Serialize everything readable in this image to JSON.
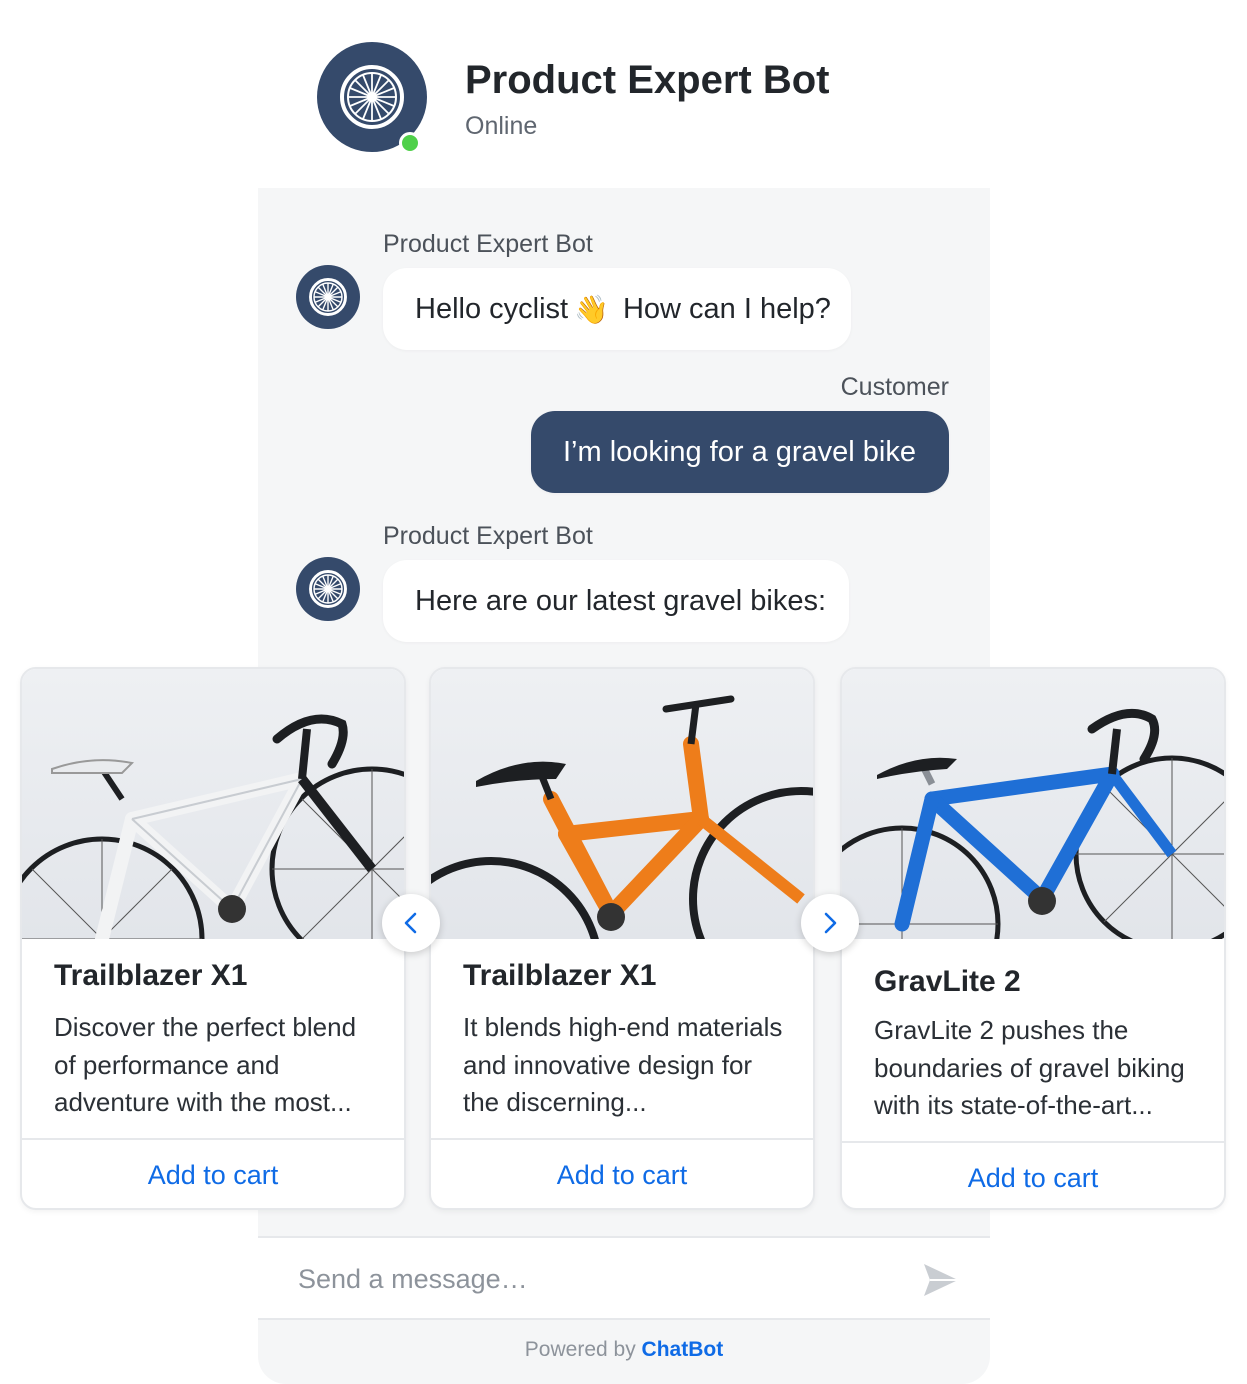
{
  "header": {
    "bot_name": "Product Expert Bot",
    "status": "Online",
    "status_color": "#4fd04a"
  },
  "messages": [
    {
      "sender": "Product Expert Bot",
      "text_before": "Hello cyclist",
      "emoji": "👋",
      "text_after": "How can I help?"
    },
    {
      "sender": "Customer",
      "text": "I’m looking for a gravel bike"
    },
    {
      "sender": "Product Expert Bot",
      "text": "Here are our latest gravel bikes:"
    }
  ],
  "cards": [
    {
      "title": "Trailblazer X1",
      "description": "Discover the perfect blend of performance and adventure with the most...",
      "button": "Add to cart",
      "frame_color": "#f2f3f4"
    },
    {
      "title": "Trailblazer X1",
      "description": "It blends high-end materials and innovative design for the discerning...",
      "button": "Add to cart",
      "frame_color": "#ee7d1a"
    },
    {
      "title": "GravLite 2",
      "description": "GravLite 2 pushes the boundaries of gravel biking with its state-of-the-art...",
      "button": "Add to cart",
      "frame_color": "#1f6fd6"
    }
  ],
  "composer": {
    "placeholder": "Send a message…"
  },
  "footer": {
    "prefix": "Powered by",
    "brand": "ChatBot"
  },
  "colors": {
    "accent": "#0f6be6",
    "bot_avatar": "#354a6b",
    "user_bubble": "#354a6b"
  }
}
